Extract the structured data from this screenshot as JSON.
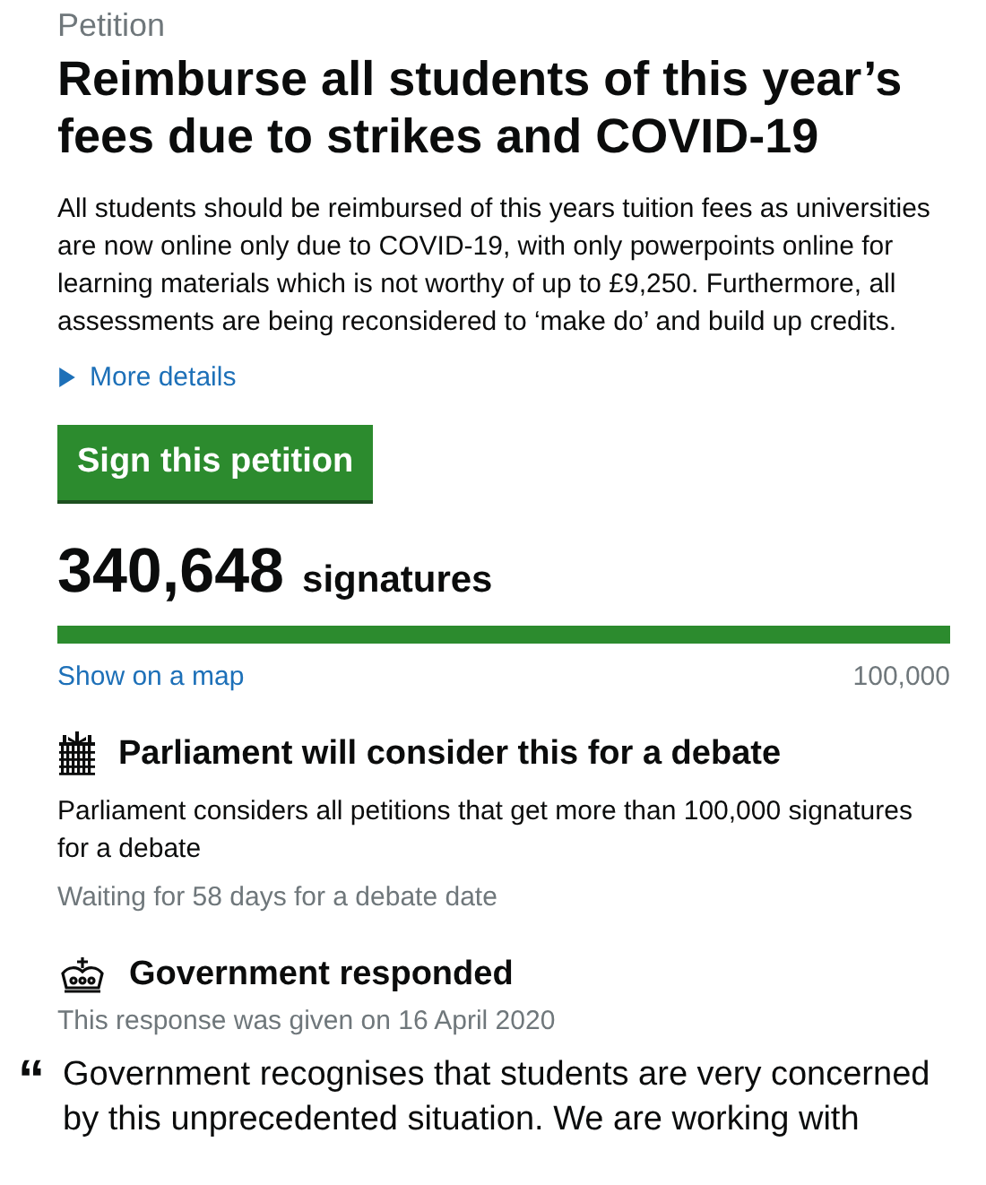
{
  "caption": "Petition",
  "title": "Reimburse all students of this year’s fees due to strikes and COVID-19",
  "description": "All students should be reimbursed of this years tuition fees as universities are now online only due to COVID-19, with only powerpoints online for learning materials which is not worthy of up to £9,250. Furthermore, all assessments are being reconsidered to ‘make do’ and build up credits.",
  "details": {
    "label": "More details",
    "expanded": false
  },
  "sign_button": "Sign this petition",
  "signatures": {
    "count": "340,648",
    "label": "signatures",
    "level": 1,
    "map_link": "Show on a map",
    "target": "100,000"
  },
  "sections": [
    {
      "kind": "parliament",
      "heading": "Parliament will consider this for a debate",
      "text": "Parliament considers all petitions that get more than 100,000 signatures for a debate",
      "note": "Waiting for 58 days for a debate date"
    },
    {
      "kind": "government",
      "heading": "Government responded",
      "note": "This response was given on 16 April 2020"
    }
  ],
  "response": {
    "quote_mark": "“",
    "text": "Government recognises that students are very concerned by this unprecedented situation. We are working with"
  }
}
